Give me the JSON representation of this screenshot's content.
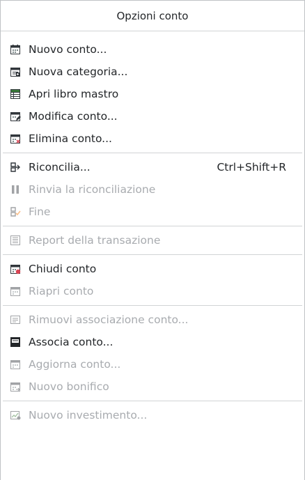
{
  "menu": {
    "title": "Opzioni conto",
    "groups": [
      [
        {
          "label": "Nuovo conto...",
          "icon": "calendar-new-icon",
          "enabled": true
        },
        {
          "label": "Nuova categoria...",
          "icon": "category-new-icon",
          "enabled": true
        },
        {
          "label": "Apri libro mastro",
          "icon": "ledger-icon",
          "enabled": true
        },
        {
          "label": "Modifica conto...",
          "icon": "calendar-edit-icon",
          "enabled": true
        },
        {
          "label": "Elimina conto...",
          "icon": "calendar-delete-icon",
          "enabled": true
        }
      ],
      [
        {
          "label": "Riconcilia...",
          "icon": "reconcile-icon",
          "enabled": true,
          "shortcut": "Ctrl+Shift+R"
        },
        {
          "label": "Rinvia la riconciliazione",
          "icon": "pause-icon",
          "enabled": false
        },
        {
          "label": "Fine",
          "icon": "finish-icon",
          "enabled": false
        }
      ],
      [
        {
          "label": "Report della transazione",
          "icon": "report-icon",
          "enabled": false
        }
      ],
      [
        {
          "label": "Chiudi conto",
          "icon": "calendar-close-icon",
          "enabled": true
        },
        {
          "label": "Riapri conto",
          "icon": "calendar-reopen-icon",
          "enabled": false
        }
      ],
      [
        {
          "label": "Rimuovi associazione conto...",
          "icon": "unlink-icon",
          "enabled": false
        },
        {
          "label": "Associa conto...",
          "icon": "link-account-icon",
          "enabled": true
        },
        {
          "label": "Aggiorna conto...",
          "icon": "calendar-update-icon",
          "enabled": false
        },
        {
          "label": "Nuovo bonifico",
          "icon": "calendar-transfer-icon",
          "enabled": false
        }
      ],
      [
        {
          "label": "Nuovo investimento...",
          "icon": "investment-icon",
          "enabled": false
        }
      ]
    ]
  }
}
